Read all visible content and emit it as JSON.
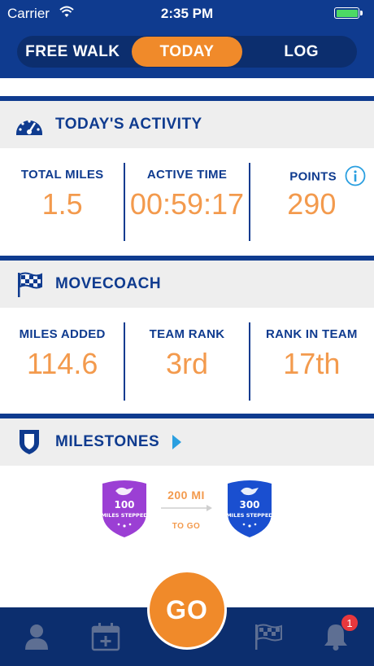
{
  "status_bar": {
    "carrier": "Carrier",
    "time": "2:35 PM"
  },
  "segmented": {
    "tabs": [
      "FREE WALK",
      "TODAY",
      "LOG"
    ],
    "active": "TODAY"
  },
  "todays_activity": {
    "title": "TODAY'S ACTIVITY",
    "stats": [
      {
        "label": "TOTAL MILES",
        "value": "1.5"
      },
      {
        "label": "ACTIVE TIME",
        "value": "00:59:17"
      },
      {
        "label": "POINTS",
        "value": "290"
      }
    ]
  },
  "movecoach": {
    "title": "MOVECOACH",
    "stats": [
      {
        "label": "MILES ADDED",
        "value": "114.6"
      },
      {
        "label": "TEAM RANK",
        "value": "3rd"
      },
      {
        "label": "RANK IN TEAM",
        "value": "17th"
      }
    ]
  },
  "milestones": {
    "title": "MILESTONES",
    "current_badge": {
      "number": "100",
      "caption": "MILES STEPPED"
    },
    "next_badge": {
      "number": "300",
      "caption": "MILES STEPPED"
    },
    "distance": "200 MI",
    "to_go": "TO GO"
  },
  "go_button": {
    "label": "GO"
  },
  "notifications": {
    "count": "1"
  },
  "colors": {
    "brand_blue": "#0f3b8f",
    "dark_blue": "#0c2e6e",
    "accent_orange": "#f08a2a",
    "value_orange": "#f39a4d",
    "badge_purple": "#9b3fd4",
    "badge_blue": "#1a4fd0"
  }
}
